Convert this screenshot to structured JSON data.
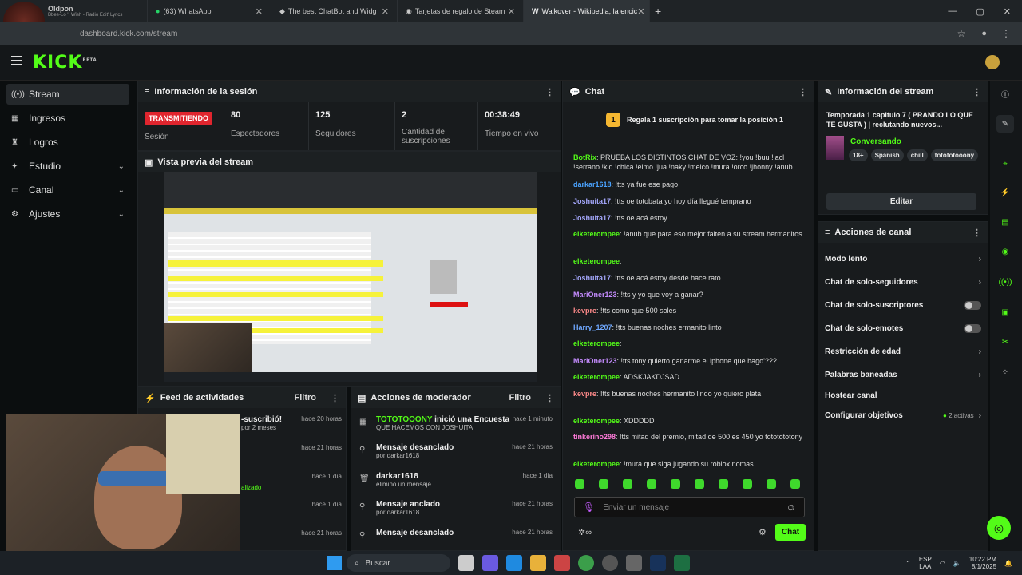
{
  "browser": {
    "tabs": [
      {
        "label": "Oldpon",
        "sub": "Bbee-Lo 'I Wish - Radio Edit' Lyrics"
      },
      {
        "label": "(63) WhatsApp"
      },
      {
        "label": "The best ChatBot and Widg"
      },
      {
        "label": "Tarjetas de regalo de Steam"
      },
      {
        "label": "Walkover - Wikipedia, la encic"
      }
    ],
    "url": "dashboard.kick.com/stream",
    "new_tab": "+"
  },
  "app": {
    "logo": "KICK",
    "logo_sup": "BETA",
    "accent": "#53fc18"
  },
  "sidebar": {
    "items": [
      {
        "label": "Stream",
        "icon": "stream-icon"
      },
      {
        "label": "Ingresos",
        "icon": "money-icon"
      },
      {
        "label": "Logros",
        "icon": "trophy-icon"
      },
      {
        "label": "Estudio",
        "icon": "studio-icon"
      },
      {
        "label": "Canal",
        "icon": "channel-icon"
      },
      {
        "label": "Ajustes",
        "icon": "gear-icon"
      }
    ]
  },
  "session": {
    "title": "Información de la sesión",
    "live_badge": "TRANSMITIENDO",
    "session_label": "Sesión",
    "stats": [
      {
        "value": "80",
        "label": "Espectadores"
      },
      {
        "value": "125",
        "label": "Seguidores"
      },
      {
        "value": "2",
        "label": "Cantidad de suscripciones"
      },
      {
        "value": "00:38:49",
        "label": "Tiempo en vivo"
      }
    ]
  },
  "preview": {
    "title": "Vista previa del stream"
  },
  "feed": {
    "title": "Feed de actividades",
    "filter": "Filtro",
    "rows": [
      {
        "text": "-suscribió!",
        "sub": "por 2 meses",
        "time": "hace 20 horas"
      },
      {
        "text": "",
        "sub": "",
        "time": "hace 21 horas"
      },
      {
        "text": "",
        "sub": "alizado",
        "time": "hace 1 día"
      },
      {
        "text": "",
        "sub": "",
        "time": "hace 1 día"
      },
      {
        "text": "",
        "sub": "",
        "time": "hace 21 horas"
      }
    ]
  },
  "mod": {
    "title": "Acciones de moderador",
    "filter": "Filtro",
    "rows": [
      {
        "title_user": "TOTOTOOONY",
        "title": " inició una Encuesta",
        "sub": "QUE HACEMOS CON JOSHUITA",
        "time": "hace 1 minuto"
      },
      {
        "title": "Mensaje desanclado",
        "sub": "por darkar1618",
        "time": "hace 21 horas"
      },
      {
        "title": "darkar1618",
        "sub": "eliminó un mensaje",
        "time": "hace 1 día"
      },
      {
        "title": "Mensaje anclado",
        "sub": "por darkar1618",
        "time": "hace 21 horas"
      },
      {
        "title": "Mensaje desanclado",
        "sub": "",
        "time": "hace 21 horas"
      }
    ]
  },
  "chat": {
    "title": "Chat",
    "pinned": "Regala 1 suscripción para tomar la posición 1",
    "pinned_num": "1",
    "messages": [
      {
        "user": "BotRix",
        "color": "#53fc18",
        "text": ": PRUEBA LOS DISTINTOS CHAT DE VOZ: !you !buu !jacl !serrano !kid !chica !elmo !jua !naky !melco !mura !orco !jhonny !anub"
      },
      {
        "user": "darkar1618",
        "color": "#4aa3ff",
        "text": ": !tts ya fue ese pago"
      },
      {
        "user": "Joshuita17",
        "color": "#a6a9ff",
        "text": ": !tts oe totobata yo hoy día llegué temprano"
      },
      {
        "user": "Joshuita17",
        "color": "#a6a9ff",
        "text": ": !tts oe acá estoy"
      },
      {
        "user": "elketerompee",
        "color": "#53fc18",
        "text": ": !anub que para eso mejor falten a su stream hermanitos"
      },
      {
        "user": "elketerompee",
        "color": "#53fc18",
        "text": ":"
      },
      {
        "user": "Joshuita17",
        "color": "#a6a9ff",
        "text": ": !tts oe acá estoy desde hace rato"
      },
      {
        "user": "MariOner123",
        "color": "#c58cff",
        "text": ": !tts y yo que voy a ganar?"
      },
      {
        "user": "kevpre",
        "color": "#ff8a8a",
        "text": ": !tts como que 500 soles"
      },
      {
        "user": "Harry_1207",
        "color": "#6fa8ff",
        "text": ": !tts buenas noches ermanito linto"
      },
      {
        "user": "elketerompee",
        "color": "#53fc18",
        "text": ":"
      },
      {
        "user": "MariOner123",
        "color": "#c58cff",
        "text": ": !tts tony quierto ganarme el iphone que hago'???"
      },
      {
        "user": "elketerompee",
        "color": "#53fc18",
        "text": ": ADSKJAKDJSAD"
      },
      {
        "user": "kevpre",
        "color": "#ff8a8a",
        "text": ": !tts buenas noches hermanito lindo yo quiero plata"
      },
      {
        "user": "elketerompee",
        "color": "#53fc18",
        "text": ": XDDDDD"
      },
      {
        "user": "tinkerino298",
        "color": "#ff7ad9",
        "text": ": !tts mitad del premio, mitad de 500 es 450 yo tototototony"
      },
      {
        "user": "elketerompee",
        "color": "#53fc18",
        "text": ": !mura que siga jugando su roblox nomas"
      }
    ],
    "input_placeholder": "Enviar un mensaje",
    "send_label": "Chat"
  },
  "stream_info": {
    "title": "Información del stream",
    "stream_title": "Temporada 1 capitulo 7 ( PRANDO LO QUE TE GUSTA ) | reclutando nuevos...",
    "category": "Conversando",
    "tags": [
      "18+",
      "Spanish",
      "chill",
      "totototooony"
    ],
    "edit_label": "Editar"
  },
  "channel_actions": {
    "title": "Acciones de canal",
    "items": [
      {
        "label": "Modo lento",
        "control": "chevron"
      },
      {
        "label": "Chat de solo-seguidores",
        "control": "chevron"
      },
      {
        "label": "Chat de solo-suscriptores",
        "control": "toggle"
      },
      {
        "label": "Chat de solo-emotes",
        "control": "toggle"
      },
      {
        "label": "Restricción de edad",
        "control": "chevron"
      },
      {
        "label": "Palabras baneadas",
        "control": "chevron"
      },
      {
        "label": "Hostear canal",
        "control": "none"
      },
      {
        "label": "Configurar objetivos",
        "control": "chevron",
        "extra": "2 activas"
      }
    ]
  },
  "taskbar": {
    "search": "Buscar",
    "lang": "ESP",
    "lang2": "LAA",
    "time": "10:22 PM",
    "date": "8/1/2025"
  }
}
